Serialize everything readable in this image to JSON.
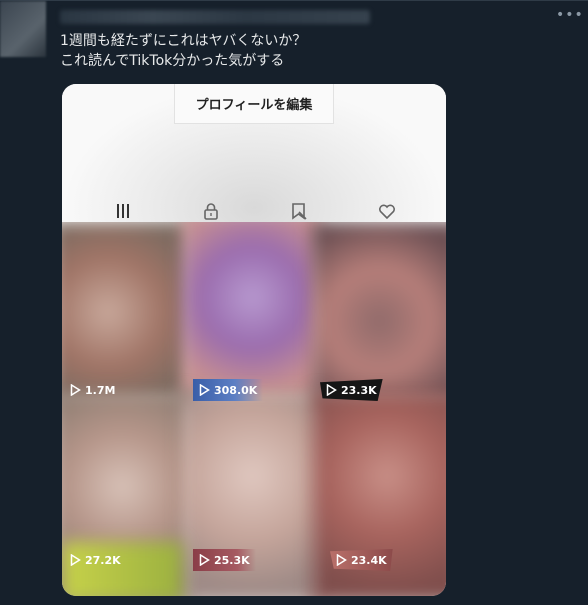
{
  "tweet": {
    "more_icon": "more-horizontal-icon",
    "lines": [
      "1週間も経たずにこれはヤバくないか？",
      "これ読んでTikTok分かった気がする"
    ]
  },
  "screenshot": {
    "edit_profile_label": "プロフィールを編集",
    "tab_icons": [
      "grid-icon",
      "lock-icon",
      "bookmark-icon",
      "liked-icon"
    ],
    "views": [
      "1.7M",
      "308.0K",
      "23.3K",
      "27.2K",
      "25.3K",
      "23.4K"
    ],
    "play_icon": "play-icon"
  }
}
